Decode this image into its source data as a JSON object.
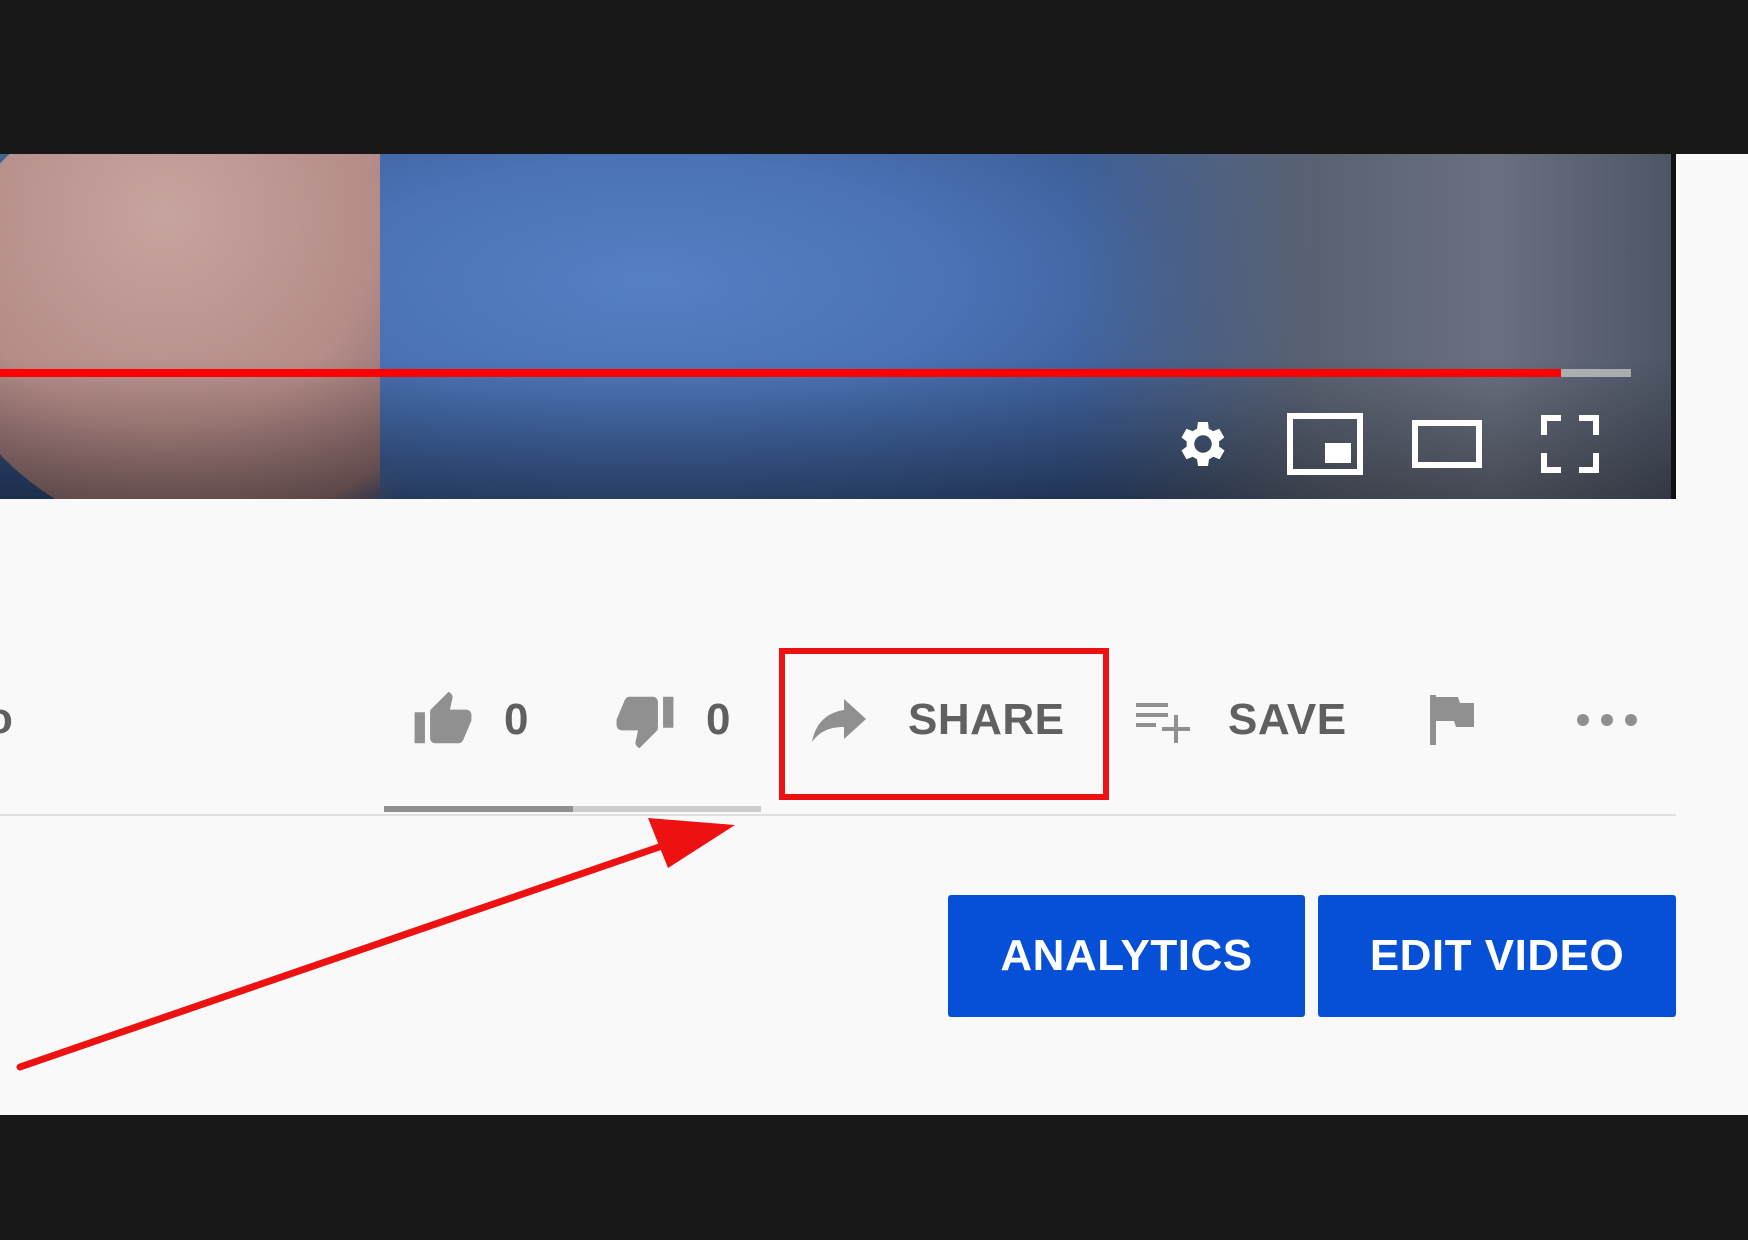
{
  "player": {
    "progress_played_fraction": 0.957,
    "controls": {
      "settings": "gear-icon",
      "miniplayer": "miniplayer-icon",
      "theater": "theater-mode-icon",
      "fullscreen": "fullscreen-icon"
    }
  },
  "actions": {
    "cut_label": "o",
    "like_count": "0",
    "dislike_count": "0",
    "share_label": "SHARE",
    "save_label": "SAVE",
    "like_fraction": 0.5
  },
  "buttons": {
    "analytics_label": "ANALYTICS",
    "edit_video_label": "EDIT VIDEO"
  },
  "colors": {
    "progress_red": "#ff0000",
    "button_blue": "#0650d8",
    "annotation_red": "#ee1111",
    "icon_gray": "#606060"
  }
}
